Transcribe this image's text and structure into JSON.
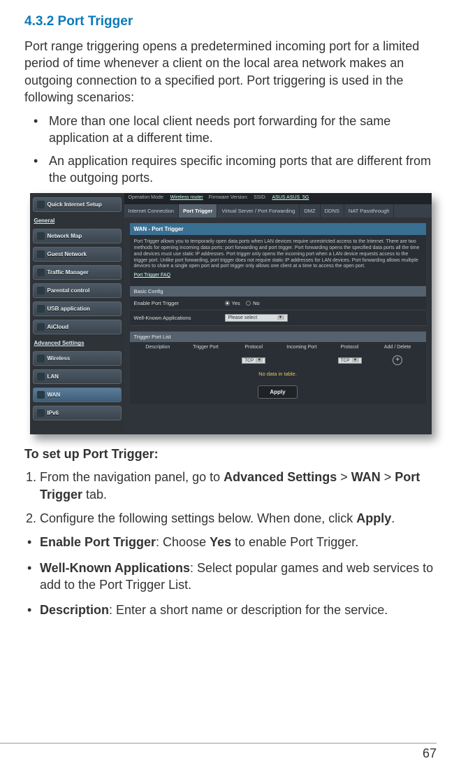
{
  "section": {
    "number": "4.3.2",
    "title": "Port Trigger"
  },
  "intro": "Port range triggering opens a predetermined incoming port for a limited period of time whenever a client on the local area network makes an outgoing connection to a specified port. Port triggering is used in the following scenarios:",
  "scenarios": [
    "More than one local client needs port forwarding for the same application at a different time.",
    "An application requires specific incoming ports that are different from the outgoing ports."
  ],
  "screenshot": {
    "topbar": {
      "mode_label": "Operation Mode:",
      "mode": "Wireless router",
      "fw_label": "Firmware Version:",
      "ssid_label": "SSID:",
      "ssid": "ASUS  ASUS_5G"
    },
    "sidebar": {
      "quick": "Quick Internet Setup",
      "general_heading": "General",
      "items": [
        "Network Map",
        "Guest Network",
        "Traffic Manager",
        "Parental control",
        "USB application",
        "AiCloud"
      ],
      "adv_heading": "Advanced Settings",
      "adv_items": [
        "Wireless",
        "LAN",
        "WAN",
        "IPv6"
      ]
    },
    "tabs": [
      "Internet Connection",
      "Port Trigger",
      "Virtual Server / Port Forwarding",
      "DMZ",
      "DDNS",
      "NAT Passthrough"
    ],
    "panel": {
      "title": "WAN - Port Trigger",
      "body": "Port Trigger allows you to temporarily open data ports when LAN devices require unrestricted access to the Internet. There are two methods for opening incoming data ports: port forwarding and port trigger. Port forwarding opens the specified data ports all the time and devices must use static IP addresses. Port trigger only opens the incoming port when a LAN device requests access to the trigger port. Unlike port forwarding, port trigger does not require static IP addresses for LAN devices. Port forwarding allows multiple devices to share a single open port and port trigger only allows one client at a time to access the open port.",
      "faq": "Port Trigger FAQ"
    },
    "basic": {
      "title": "Basic Config",
      "enable_label": "Enable Port Trigger",
      "yes": "Yes",
      "no": "No",
      "wka_label": "Well-Known Applications",
      "wka_value": "Please select"
    },
    "tlist": {
      "title": "Trigger Port List",
      "cols": [
        "Description",
        "Trigger Port",
        "Protocol",
        "Incoming Port",
        "Protocol",
        "Add / Delete"
      ],
      "proto": "TCP",
      "nodata": "No data in table.",
      "apply": "Apply"
    }
  },
  "setup_heading": "To set up Port Trigger:",
  "steps": {
    "s1_a": "From the navigation panel, go to ",
    "s1_b": "Advanced Settings",
    "s1_c": " > ",
    "s1_d": "WAN",
    "s1_e": " > ",
    "s1_f": "Port Trigger",
    "s1_g": " tab.",
    "s2_a": "Configure the following settings below. When done, click ",
    "s2_b": "Apply",
    "s2_c": "."
  },
  "opts": {
    "o1_a": "Enable Port Trigger",
    "o1_b": ": Choose ",
    "o1_c": "Yes",
    "o1_d": " to enable Port Trigger.",
    "o2_a": "Well-Known Applications",
    "o2_b": ": Select popular games and web services to add to the Port Trigger List.",
    "o3_a": "Description",
    "o3_b": ": Enter a short name or description for the service."
  },
  "page_number": "67"
}
